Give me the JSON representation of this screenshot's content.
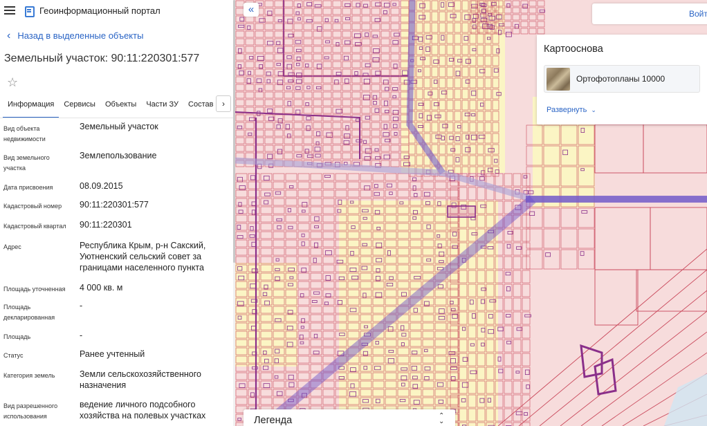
{
  "header": {
    "title": "Геоинформационный портал"
  },
  "nav": {
    "back_label": "Назад в выделенные объекты"
  },
  "object": {
    "title": "Земельный участок: 90:11:220301:577"
  },
  "tabs": [
    {
      "label": "Информация"
    },
    {
      "label": "Сервисы"
    },
    {
      "label": "Объекты"
    },
    {
      "label": "Части ЗУ"
    },
    {
      "label": "Состав"
    }
  ],
  "attributes": [
    {
      "label": "Вид объекта недвижимости",
      "value": "Земельный участок"
    },
    {
      "label": "Вид земельного участка",
      "value": "Землепользование"
    },
    {
      "label": "Дата присвоения",
      "value": "08.09.2015"
    },
    {
      "label": "Кадастровый номер",
      "value": "90:11:220301:577"
    },
    {
      "label": "Кадастровый квартал",
      "value": "90:11:220301"
    },
    {
      "label": "Адрес",
      "value": "Республика Крым, р-н Сакский, Уютненский сельский совет за границами населенного пункта"
    },
    {
      "label": "Площадь уточненная",
      "value": "4 000 кв. м"
    },
    {
      "label": "Площадь декларированная",
      "value": "-"
    },
    {
      "label": "Площадь",
      "value": "-"
    },
    {
      "label": "Статус",
      "value": "Ранее учтенный"
    },
    {
      "label": "Категория земель",
      "value": "Земли сельскохозяйственного назначения"
    },
    {
      "label": "Вид разрешенного использования",
      "value": "ведение личного подсобного хозяйства на полевых участках"
    }
  ],
  "map": {
    "login_label": "Войти",
    "basemap": {
      "title": "Картооснова",
      "selected": "Ортофотопланы 10000",
      "expand_label": "Развернуть"
    },
    "legend_label": "Легенда",
    "colors": {
      "parcel_fill": "#f7dcdc",
      "field_fill": "#fbf5c4",
      "parcel_stroke": "#c9485b",
      "quarter_stroke": "#8a2f8a",
      "road_band": "#6a4fc8"
    }
  }
}
